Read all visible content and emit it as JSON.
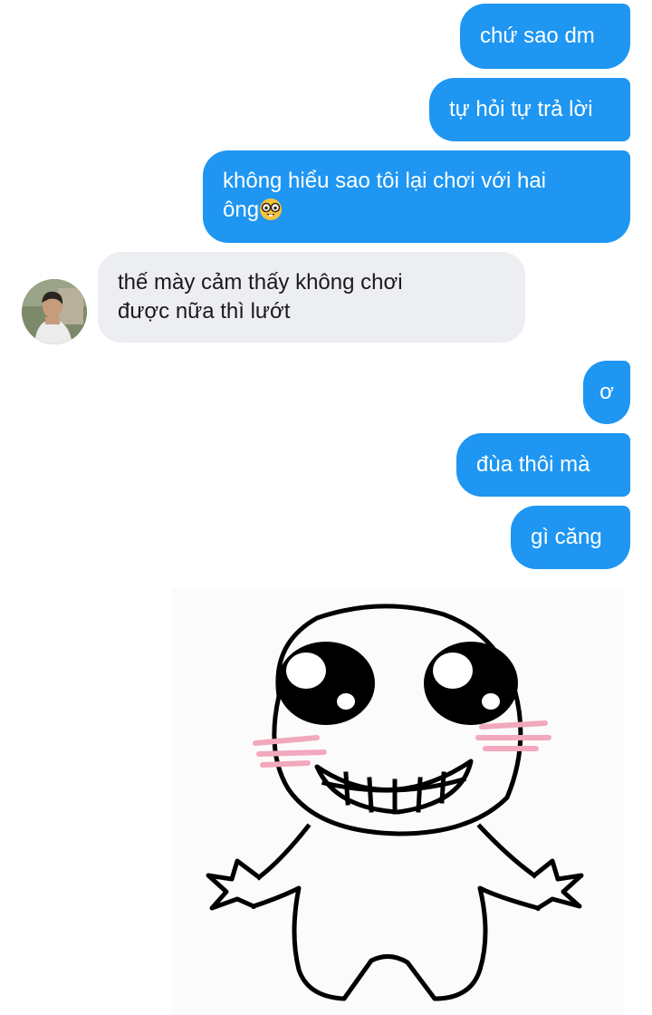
{
  "conversation": {
    "messages": [
      {
        "id": "m1",
        "sender": "me",
        "text": "chứ sao dm"
      },
      {
        "id": "m2",
        "sender": "me",
        "text": "tự hỏi tự trả lời"
      },
      {
        "id": "m3",
        "sender": "me",
        "line1": "không hiểu sao tôi lại chơi với hai",
        "line2": "ông",
        "emoji": "nerd-face-icon"
      },
      {
        "id": "m4",
        "sender": "other",
        "line1": "thế mày cảm thấy không chơi",
        "line2": "được nữa thì lướt"
      },
      {
        "id": "m5",
        "sender": "me",
        "text": "ơ"
      },
      {
        "id": "m6",
        "sender": "me",
        "text": "đùa thôi mà"
      },
      {
        "id": "m7",
        "sender": "me",
        "text": "gì căng"
      },
      {
        "id": "m8",
        "sender": "me",
        "sticker": "grinning-stick-figure-sticker"
      }
    ]
  },
  "colors": {
    "outgoing_bubble": "#1e96f2",
    "incoming_bubble": "#eceef1",
    "background": "#ffffff"
  }
}
